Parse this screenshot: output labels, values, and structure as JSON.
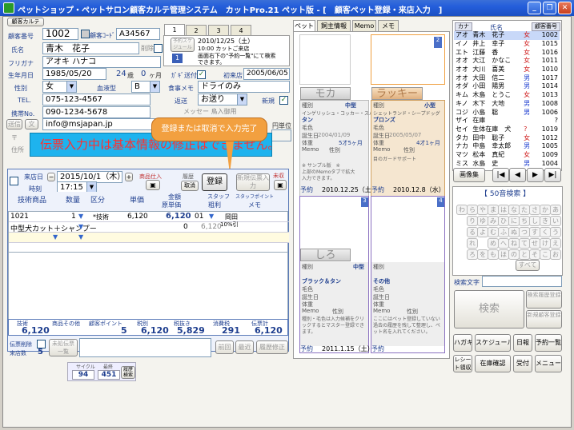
{
  "window": {
    "title": "ペットショップ・ペットサロン顧客カルテ管理システム　カットPro.21 ペット版 - [　顧客ペット登録・来店入力　]",
    "minimize": "_",
    "restore": "❐",
    "close": "✕"
  },
  "customer": {
    "section_tab": "顧客カルテ",
    "id_label": "顧客番号",
    "id_value": "1002",
    "code_label": "顧客ｺｰﾄﾞ",
    "code_value": "A34567",
    "name_label": "氏名",
    "name_value": "青木　花子",
    "delete_label": "削除",
    "furigana_label": "フリガナ",
    "furigana_value": "アオキ ハナコ",
    "birthday_label": "生年月日",
    "birthday_value": "1985/05/20",
    "age_years": "24",
    "age_years_unit": "歳",
    "age_months": "0",
    "age_months_unit": "ヶ月",
    "gender_label": "性別",
    "gender_value": "女",
    "blood_label": "血液型",
    "blood_value": "B",
    "tel_label": "TEL.",
    "tel_value": "075-123-4567",
    "mobile_label": "携帯No.",
    "mobile_value": "090-1234-5678",
    "mail_label": "送信",
    "mail_btn2": "文",
    "mail_value": "info@msjapan.jp",
    "postal_label": "〒",
    "address_label": "住所",
    "dm_label": "ｶﾞｷﾞ送付",
    "first_visit_label": "初来店",
    "first_visit_value": "2005/06/05",
    "memo_label": "食事メモ",
    "memo_value": "ドライのみ",
    "delivery_label": "返送",
    "delivery_value": "お送り",
    "new_label": "新規",
    "ghost_text_1": "メッセー 鳥入御用",
    "ghost_text_2": "円単位"
  },
  "reservation": {
    "tabs": [
      "1",
      "2",
      "3",
      "4"
    ],
    "schedule_btn": "予約スケジュール",
    "date": "2010/12/25（土）",
    "line1": "10:00 カットご来店",
    "line2": "画面右下の\"予約一覧\"にて検索",
    "line3": "できます。",
    "count_badge": "1"
  },
  "banner": {
    "text": "伝票入力中は基本情報の修正はできません。"
  },
  "tooltip": {
    "text": "登録または取消で入力完了"
  },
  "visit": {
    "visit_day_label": "来店日",
    "visit_date": "2015/10/1（木）",
    "time_label": "時刻",
    "time_value": "17:15",
    "product_label": "商品仕入",
    "history_label": "履歴",
    "cancel_label": "取消",
    "register_label": "登録",
    "new_slip_label": "新規伝票入力",
    "unfinished_label": "未収",
    "col_headers": [
      "技術商品",
      "数量",
      "区分",
      "単価",
      "金額",
      "スタッフ",
      "スタッフポイント"
    ],
    "col_sub_headers": [
      "原単価",
      "粗利",
      "メモ"
    ],
    "rows": [
      {
        "code": "1021",
        "qty": "1",
        "kind": "*技術",
        "price": "6,120",
        "amount": "6,120",
        "staff": "01",
        "name": "岡田",
        "note": "10%引"
      },
      {
        "code": "中型犬カット＋シャンプー",
        "qty": "",
        "kind": "",
        "price": "",
        "amount": "0",
        "staff": "6,120",
        "name": "",
        "note": ""
      }
    ],
    "totals_headers": [
      "技術",
      "商品その他",
      "顧客ポイント",
      "税別",
      "税抜き",
      "消費税",
      "伝票計"
    ],
    "totals_values": [
      "6,120",
      "",
      "5",
      "6,120",
      "5,829",
      "291",
      "6,120"
    ],
    "slip_delete_label": "伝票削除",
    "visit_count_label": "来店数",
    "visit_count": "5",
    "unfinished_slip_label": "未処伝票一覧",
    "memo_label": "メモ",
    "prev_label": "前回",
    "recent_label": "最近",
    "history_fix_label": "履歴修正",
    "cycle_label": "サイクル",
    "cycle_sub": "最終",
    "cycle_value": "94",
    "last_value": "451",
    "history_badge": "履歴検索"
  },
  "pets": {
    "tabs": [
      "ペット",
      "飼主情報",
      "Memo",
      "メモ"
    ],
    "cards": [
      {
        "name": "モカ",
        "breed": "インゲリッシュ・コッカー・スパニエル",
        "size": "中型",
        "coat": "タン",
        "birth": "2004/01/09",
        "weight": "5才5ヶ月",
        "memo": "※ サンプル版　※\n上部のMemoタブで拡大\n入力できます。",
        "reserve_label": "予約",
        "reserve_date": "2010.12.25（土）",
        "active": false
      },
      {
        "name": "ラッキー",
        "breed": "シェットランド・シープドッグ",
        "size": "小型",
        "coat": "ブロンズ",
        "birth": "2005/05/07",
        "weight": "4才1ヶ月",
        "memo": "目のガードサポート",
        "reserve_label": "予約",
        "reserve_date": "2010.12.8（水）",
        "active": true
      },
      {
        "name": "しろ",
        "breed": "",
        "size": "中型",
        "coat": "ブラック＆タン",
        "birth": "",
        "weight": "",
        "memo": "種別・毛色は入力候補をクリックするとマスター登録できます。",
        "reserve_label": "予約",
        "reserve_date": "2011.1.15（土）",
        "active": false
      },
      {
        "name": "",
        "breed": "",
        "size": "",
        "coat": "その他",
        "birth": "",
        "weight": "",
        "memo": "ここにはペット登録していない過去の履歴を残して整理し、ペット名を入れてください。",
        "reserve_label": "予約",
        "reserve_date": "",
        "active": false
      }
    ],
    "field_labels": {
      "kind": "種別",
      "color": "毛色",
      "birth": "誕生日",
      "weight": "体重",
      "sex": "性別",
      "memo": "Memo"
    }
  },
  "roster": {
    "tab_label": "カナ",
    "name_header": "氏名",
    "id_header": "顧客番号",
    "rows": [
      {
        "kana": "アオ",
        "name": "青木　花子",
        "sex": "女",
        "id": "1002"
      },
      {
        "kana": "イノ",
        "name": "井上　幸子",
        "sex": "女",
        "id": "1015"
      },
      {
        "kana": "エト",
        "name": "江藤　香",
        "sex": "女",
        "id": "1016"
      },
      {
        "kana": "オオ",
        "name": "大江　かなこ",
        "sex": "女",
        "id": "1011"
      },
      {
        "kana": "オオ",
        "name": "大川　喜美",
        "sex": "女",
        "id": "1010"
      },
      {
        "kana": "オオ",
        "name": "大田　信二",
        "sex": "男",
        "id": "1017"
      },
      {
        "kana": "オダ",
        "name": "小田　陽男",
        "sex": "男",
        "id": "1014"
      },
      {
        "kana": "キム",
        "name": "木島　とうこ",
        "sex": "女",
        "id": "1013"
      },
      {
        "kana": "キノ",
        "name": "木下　大地",
        "sex": "男",
        "id": "1008"
      },
      {
        "kana": "コジ",
        "name": "小島　聡",
        "sex": "男",
        "id": "1006"
      },
      {
        "kana": "ザイ",
        "name": "在庫",
        "sex": "",
        "id": "?"
      },
      {
        "kana": "セイ",
        "name": "生体在庫　犬",
        "sex": "?",
        "id": "1019"
      },
      {
        "kana": "タカ",
        "name": "田中　聡子",
        "sex": "女",
        "id": "1012"
      },
      {
        "kana": "ナカ",
        "name": "中島　幸太郎",
        "sex": "男",
        "id": "1005"
      },
      {
        "kana": "マツ",
        "name": "松本　真紀",
        "sex": "女",
        "id": "1009"
      },
      {
        "kana": "ミス",
        "name": "水島　史",
        "sex": "男",
        "id": "1004"
      }
    ],
    "image_btn": "画像集",
    "nav": [
      "|◀",
      "◀",
      "▶",
      "▶|"
    ],
    "kana_header": "【 50音検索 】",
    "kana_rows": [
      [
        "わ",
        "ら",
        "や",
        "ま",
        "は",
        "な",
        "た",
        "さ",
        "か",
        "あ"
      ],
      [
        "",
        "り",
        "ゆ",
        "み",
        "ひ",
        "に",
        "ち",
        "し",
        "き",
        "い"
      ],
      [
        "",
        "る",
        "よ",
        "む",
        "ふ",
        "ぬ",
        "つ",
        "す",
        "く",
        "う"
      ],
      [
        "",
        "れ",
        "",
        "め",
        "へ",
        "ね",
        "て",
        "せ",
        "け",
        "え"
      ],
      [
        "",
        "ろ",
        "を",
        "も",
        "ほ",
        "の",
        "と",
        "そ",
        "こ",
        "お"
      ]
    ],
    "kana_all": "すべて",
    "search_label": "検索文字",
    "search_btn": "検索",
    "history_search_btn": "検索履歴登録",
    "new_customer_btn": "新規顧客登録",
    "bottom_buttons": [
      "ハガキ",
      "スケジュール",
      "日報",
      "予約一覧",
      "レシート領収書",
      "在庫確認",
      "受付",
      "メニュー"
    ]
  }
}
